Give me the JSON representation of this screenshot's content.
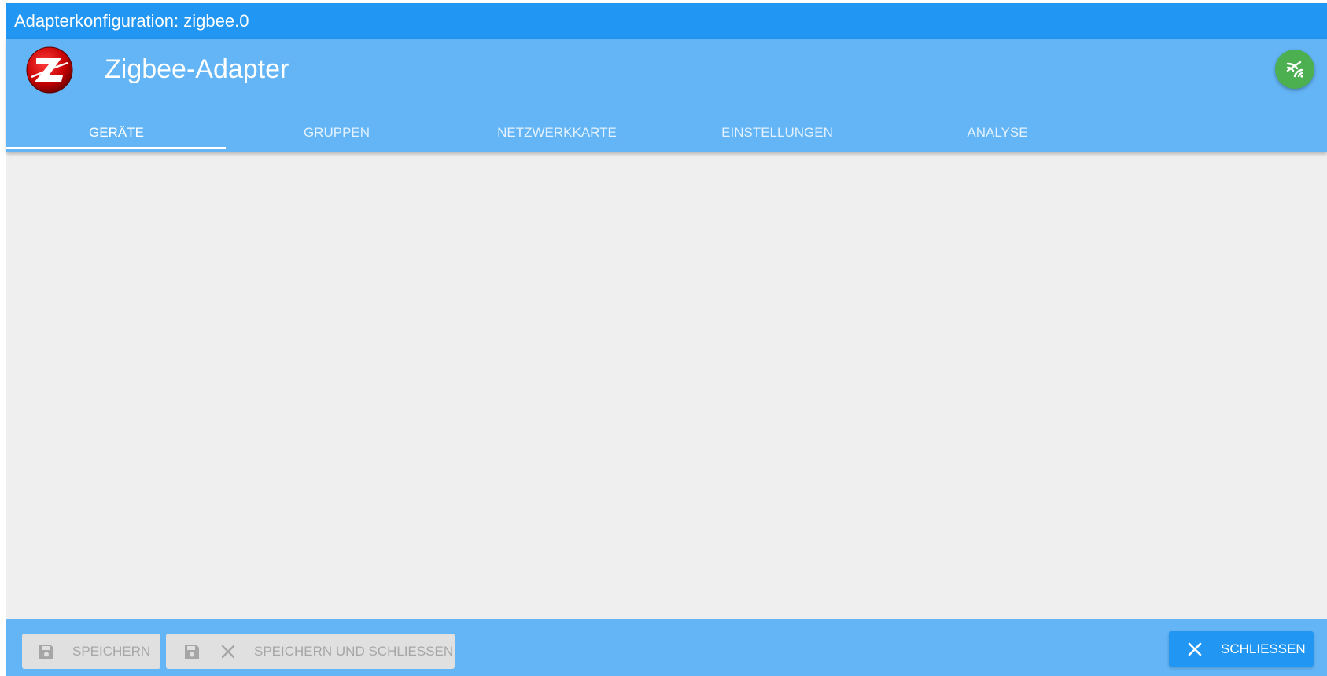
{
  "window": {
    "title": "Adapterkonfiguration: zigbee.0"
  },
  "header": {
    "title": "Zigbee-Adapter",
    "logo_icon": "zigbee-logo",
    "status_icon": "signal-icon",
    "status_color": "#4caf50"
  },
  "tabs": [
    {
      "label": "GERÄTE",
      "active": true
    },
    {
      "label": "GRUPPEN",
      "active": false
    },
    {
      "label": "NETZWERKKARTE",
      "active": false
    },
    {
      "label": "EINSTELLUNGEN",
      "active": false
    },
    {
      "label": "ANALYSE",
      "active": false
    }
  ],
  "footer": {
    "save_label": "SPEICHERN",
    "save_close_label": "SPEICHERN UND SCHLIESSEN",
    "close_label": "SCHLIESSEN"
  },
  "colors": {
    "titlebar": "#2196f3",
    "header": "#64b5f6",
    "content": "#efefef",
    "primary": "#2196f3"
  }
}
